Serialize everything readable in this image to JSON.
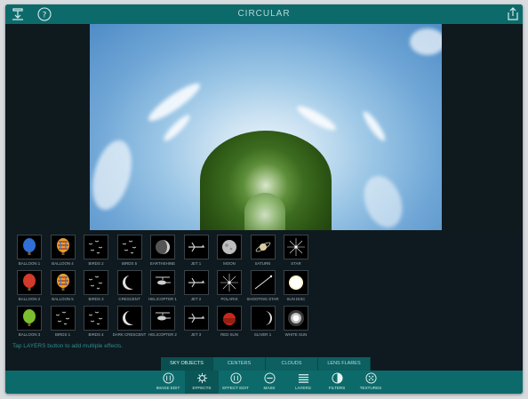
{
  "app": {
    "title": "CIRCULAR"
  },
  "effects_grid": {
    "rows": [
      [
        {
          "label": "BALLOON 1",
          "icon": "balloon-blue-icon"
        },
        {
          "label": "BALLOON 4",
          "icon": "balloon-rainbow-icon"
        },
        {
          "label": "BIRDS 2",
          "icon": "birds-icon"
        },
        {
          "label": "BIRDS 5",
          "icon": "birds-icon"
        },
        {
          "label": "EARTHSHINE",
          "icon": "moon-earthshine-icon"
        },
        {
          "label": "JET 1",
          "icon": "jet-icon"
        },
        {
          "label": "MOON",
          "icon": "moon-full-icon"
        },
        {
          "label": "SATURN",
          "icon": "saturn-icon"
        },
        {
          "label": "STAR",
          "icon": "star-flare-icon"
        }
      ],
      [
        {
          "label": "BALLOON 2",
          "icon": "balloon-red-icon"
        },
        {
          "label": "BALLOON 5",
          "icon": "balloon-rainbow-icon"
        },
        {
          "label": "BIRDS 3",
          "icon": "birds-icon"
        },
        {
          "label": "CRESCENT",
          "icon": "crescent-icon"
        },
        {
          "label": "HELICOPTER 1",
          "icon": "helicopter-icon"
        },
        {
          "label": "JET 2",
          "icon": "jet-icon"
        },
        {
          "label": "POLARIS",
          "icon": "star-flare-icon"
        },
        {
          "label": "SHOOTING STAR",
          "icon": "shooting-star-icon"
        },
        {
          "label": "SUN DISC",
          "icon": "sun-disc-icon"
        }
      ],
      [
        {
          "label": "BALLOON 3",
          "icon": "balloon-green-icon"
        },
        {
          "label": "BIRDS 1",
          "icon": "birds-icon"
        },
        {
          "label": "BIRDS 4",
          "icon": "birds-icon"
        },
        {
          "label": "DARK CRESCENT",
          "icon": "crescent-icon"
        },
        {
          "label": "HELICOPTER 2",
          "icon": "helicopter-icon"
        },
        {
          "label": "JET 3",
          "icon": "jet-icon"
        },
        {
          "label": "RED SUN",
          "icon": "red-sun-icon"
        },
        {
          "label": "SLIVER 1",
          "icon": "sliver-icon"
        },
        {
          "label": "WHITE SUN",
          "icon": "white-sun-icon"
        }
      ]
    ],
    "hint": "Tap LAYERS button to add multiple effects."
  },
  "categories": {
    "selected": "SKY OBJECTS",
    "items": [
      "SKY OBJECTS",
      "CENTERS",
      "CLOUDS",
      "LENS FLARES"
    ]
  },
  "toolbar": {
    "selected": "EFFECTS",
    "items": [
      {
        "label": "IMAGE EDIT",
        "icon": "image-edit-icon"
      },
      {
        "label": "EFFECTS",
        "icon": "effects-gear-icon"
      },
      {
        "label": "EFFECT EDIT",
        "icon": "effect-edit-icon"
      },
      {
        "label": "MASK",
        "icon": "mask-icon"
      },
      {
        "label": "LAYERS",
        "icon": "layers-icon"
      },
      {
        "label": "FILTERS",
        "icon": "filters-icon"
      },
      {
        "label": "TEXTURES",
        "icon": "textures-icon"
      }
    ]
  },
  "colors": {
    "teal": "#0d6a6b",
    "teal_dark": "#0a4f50",
    "panel": "#0e1a20",
    "hint": "#2f8d8c"
  }
}
